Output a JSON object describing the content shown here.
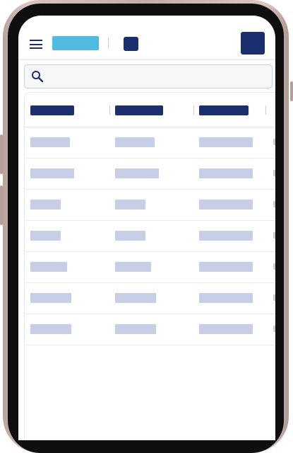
{
  "device": "phone",
  "header": {
    "menu_icon": "hamburger-menu-icon",
    "logo": "brand-logo",
    "org_badge": "organization-badge",
    "avatar": "user-avatar"
  },
  "search": {
    "icon": "search-icon",
    "value": "",
    "placeholder": ""
  },
  "table": {
    "columns": 4,
    "rows": 7,
    "content_state": "skeleton-placeholders"
  },
  "colors": {
    "navy": "#1b2f6e",
    "cyan": "#4fbcdf",
    "skeleton": "#c6cfe5",
    "border": "#e3e6ec",
    "search_bg": "#f6f7f9"
  }
}
